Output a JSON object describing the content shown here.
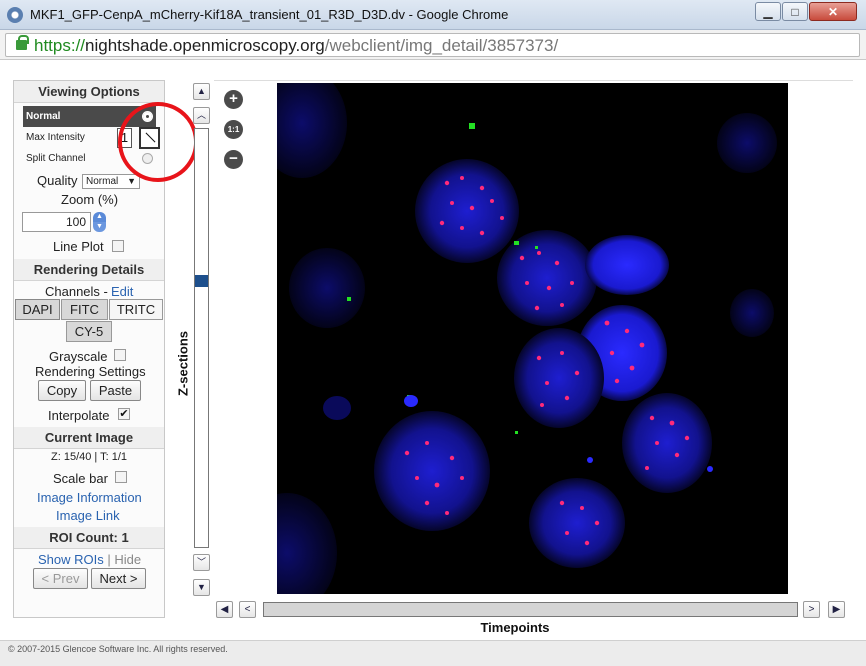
{
  "window": {
    "title": "MKF1_GFP-CenpA_mCherry-Kif18A_transient_01_R3D_D3D.dv - Google Chrome",
    "min_label": "▁",
    "max_label": "□",
    "close_label": "✕"
  },
  "address": {
    "scheme": "https://",
    "domain": "nightshade.openmicroscopy.org",
    "path": "/webclient/img_detail/3857373/"
  },
  "viewing_options": {
    "title": "Viewing Options",
    "modes": [
      {
        "label": "Normal",
        "selected": true
      },
      {
        "label": "Max Intensity",
        "selected": false
      },
      {
        "label": "Split Channel",
        "selected": false
      }
    ],
    "quality_label": "Quality",
    "quality_value": "Normal",
    "quality_arrow": "▼",
    "zoom_label": "Zoom (%)",
    "zoom_value": "100",
    "zoom_reset_label": "1",
    "line_plot_label": "Line Plot"
  },
  "rendering_details": {
    "title": "Rendering Details",
    "channels_label": "Channels -",
    "edit_label": "Edit",
    "channels": [
      {
        "label": "DAPI",
        "active": true
      },
      {
        "label": "FITC",
        "active": true
      },
      {
        "label": "TRITC",
        "active": false
      },
      {
        "label": "CY-5",
        "active": true
      }
    ],
    "grayscale_label": "Grayscale",
    "settings_label": "Rendering Settings",
    "copy_label": "Copy",
    "paste_label": "Paste",
    "interpolate_label": "Interpolate",
    "interpolate_checked": "✔"
  },
  "current_image": {
    "title": "Current Image",
    "position": "Z: 15/40 | T: 1/1",
    "scale_bar_label": "Scale bar",
    "image_info_link": "Image Information",
    "image_link": "Image Link"
  },
  "roi": {
    "title": "ROI Count: 1",
    "show_label": "Show ROIs",
    "separator": "|",
    "hide_label": "Hide",
    "prev_label": "< Prev",
    "next_label": "Next >"
  },
  "zslider": {
    "label": "Z-sections",
    "top_icon": "▲",
    "up_icon": "︿",
    "down_icon": "﹀",
    "bottom_icon": "▼",
    "current": 15,
    "total": 40
  },
  "viewport": {
    "zoom_in_label": "+",
    "zoom_one_label": "1:1",
    "zoom_out_label": "−"
  },
  "tslider": {
    "label": "Timepoints",
    "first_icon": "◀",
    "prev_icon": "<",
    "next_icon": ">",
    "last_icon": "▶"
  },
  "colors": {
    "dapi": "#1a1ad8",
    "mcherry": "#ff2a7a",
    "gfp": "#23e023",
    "annotation": "#e8141a"
  },
  "footer": {
    "copyright": "© 2007-2015 Glencoe Software Inc. All rights reserved."
  }
}
